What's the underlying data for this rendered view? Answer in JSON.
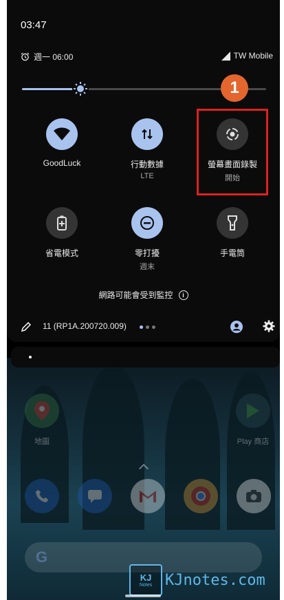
{
  "status_bar": {
    "time": "03:47",
    "alarm": "週一 06:00",
    "carrier": "TW Mobile"
  },
  "brightness": {
    "level": 0.24
  },
  "annotation": {
    "number": "1"
  },
  "tiles": [
    {
      "label": "GoodLuck",
      "sub": "",
      "state": "on",
      "icon": "wifi-icon"
    },
    {
      "label": "行動數據",
      "sub": "LTE",
      "state": "on",
      "icon": "mobile-data-icon"
    },
    {
      "label": "螢幕畫面錄製",
      "sub": "開始",
      "state": "off",
      "icon": "screen-record-icon"
    },
    {
      "label": "省電模式",
      "sub": "",
      "state": "off",
      "icon": "battery-saver-icon"
    },
    {
      "label": "零打擾",
      "sub": "週末",
      "state": "on",
      "icon": "do-not-disturb-icon"
    },
    {
      "label": "手電筒",
      "sub": "",
      "state": "off",
      "icon": "flashlight-icon"
    }
  ],
  "monitor_text": "網路可能會受到監控",
  "footer": {
    "build": "11 (RP1A.200720.009)"
  },
  "home": {
    "apps": [
      {
        "label": "地圖",
        "icon": "maps-icon"
      },
      {
        "label": "Play 商店",
        "icon": "play-store-icon"
      }
    ],
    "dock": [
      "phone-icon",
      "messages-icon",
      "gmail-icon",
      "chrome-icon",
      "camera-icon"
    ]
  },
  "watermark": {
    "logo": "KJ",
    "logo_sub": "Notes",
    "text": "KJnotes.com"
  },
  "colors": {
    "accent": "#a9c3ef",
    "highlight": "#e0201e",
    "badge": "#e4662e"
  }
}
